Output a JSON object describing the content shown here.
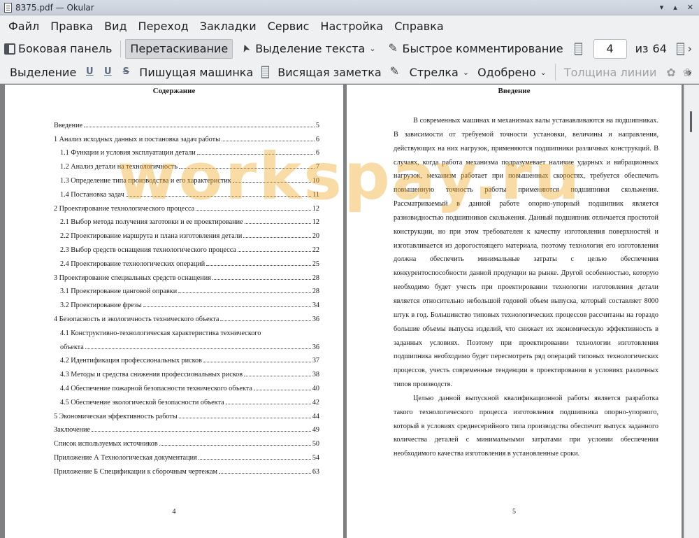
{
  "window": {
    "title": "8375.pdf — Okular"
  },
  "menu": [
    "Файл",
    "Правка",
    "Вид",
    "Переход",
    "Закладки",
    "Сервис",
    "Настройка",
    "Справка"
  ],
  "toolbar1": {
    "sidebar": "Боковая панель",
    "drag": "Перетаскивание",
    "text_select": "Выделение текста",
    "quick_annot": "Быстрое комментирование",
    "page_current": "4",
    "page_of": "из",
    "page_total": "64"
  },
  "toolbar2": {
    "highlight": "Выделение",
    "typewriter": "Пишущая машинка",
    "note": "Висящая заметка",
    "arrow": "Стрелка",
    "approved": "Одобрено",
    "line_width": "Толщина линии"
  },
  "left_page": {
    "title": "Содержание",
    "number": "4",
    "toc": [
      {
        "text": "Введение",
        "page": "5",
        "level": 1
      },
      {
        "text": "1 Анализ исходных данных и постановка задач работы",
        "page": "6",
        "level": 1
      },
      {
        "text": "1.1 Функции и условия эксплуатации детали",
        "page": "6",
        "level": 2
      },
      {
        "text": "1.2 Анализ детали на технологичность",
        "page": "7",
        "level": 2
      },
      {
        "text": "1.3 Определение типа производства и его характеристик",
        "page": "10",
        "level": 2
      },
      {
        "text": "1.4 Постановка задач",
        "page": "11",
        "level": 2
      },
      {
        "text": "2 Проектирование технологического процесса",
        "page": "12",
        "level": 1
      },
      {
        "text": "2.1 Выбор метода получения заготовки и ее проектирование",
        "page": "12",
        "level": 2
      },
      {
        "text": "2.2 Проектирование маршрута и плана изготовления детали",
        "page": "20",
        "level": 2
      },
      {
        "text": "2.3 Выбор средств оснащения технологического процесса",
        "page": "22",
        "level": 2
      },
      {
        "text": "2.4 Проектирование технологических операций",
        "page": "25",
        "level": 2
      },
      {
        "text": "3 Проектирование специальных средств оснащения",
        "page": "28",
        "level": 1
      },
      {
        "text": "3.1 Проектирование цанговой оправки",
        "page": "28",
        "level": 2
      },
      {
        "text": "3.2 Проектирование фрезы",
        "page": "34",
        "level": 2
      },
      {
        "text": "4 Безопасность и экологичность технического объекта",
        "page": "36",
        "level": 1
      },
      {
        "text": "4.1 Конструктивно-технологическая характеристика технического",
        "page": "",
        "level": 2
      },
      {
        "text": "объекта",
        "page": "36",
        "level": 2
      },
      {
        "text": "4.2 Идентификация профессиональных рисков",
        "page": "37",
        "level": 2
      },
      {
        "text": "4.3 Методы и средства снижения профессиональных рисков",
        "page": "38",
        "level": 2
      },
      {
        "text": "4.4 Обеспечение пожарной безопасности технического объекта",
        "page": "40",
        "level": 2
      },
      {
        "text": "4.5 Обеспечение экологической безопасности объекта",
        "page": "42",
        "level": 2
      },
      {
        "text": "5 Экономическая эффективность работы",
        "page": "44",
        "level": 1
      },
      {
        "text": "Заключение",
        "page": "49",
        "level": 1
      },
      {
        "text": "Список используемых источников",
        "page": "50",
        "level": 1
      },
      {
        "text": "Приложение А Технологическая документация",
        "page": "54",
        "level": 1
      },
      {
        "text": "Приложение Б Спецификации к сборочным чертежам",
        "page": "63",
        "level": 1
      }
    ]
  },
  "right_page": {
    "title": "Введение",
    "number": "5",
    "paragraphs": [
      "В современных машинах и механизмах валы устанавливаются на подшипниках. В зависимости от требуемой точности установки, величины и направления, действующих на них нагрузок, применяются подшипники различных конструкций. В случаях, когда работа механизма подразумевает наличие ударных и вибрационных нагрузок, механизм работает при повышенных скоростях, требуется обеспечить повышенную точность работы применяются подшипники скольжения. Рассматриваемый в данной работе опорно-упорный подшипник является разновидностью подшипников скольжения. Данный подшипник отличается простотой конструкции, но при этом требователен к качеству изготовления поверхностей и изготавливается из дорогостоящего материала, поэтому технология его изготовления должна обеспечить минимальные затраты с целью обеспечения конкурентоспособности данной продукции на рынке. Другой особенностью, которую необходимо будет учесть при проектировании технологии изготовления детали является относительно небольшой годовой объем выпуска, который составляет 8000 штук в год. Большинство типовых технологических процессов рассчитаны на гораздо большие объемы выпуска изделий, что снижает их экономическую эффективность в заданных условиях. Поэтому при проектировании технологии изготовления подшипника необходимо будет пересмотреть ряд операций типовых технологических процессов, учесть современные тенденции в проектировании в условиях различных типов производств.",
      "Целью данной выпускной квалификационной работы является разработка такого технологического процесса изготовления подшипника опорно-упорного, который в условиях среднесерийного типа производства обеспечит выпуск заданного количества деталей с минимальными затратами при условии обеспечения необходимого качества изготовления в установленные сроки."
    ]
  },
  "watermark": "workspay.ru"
}
